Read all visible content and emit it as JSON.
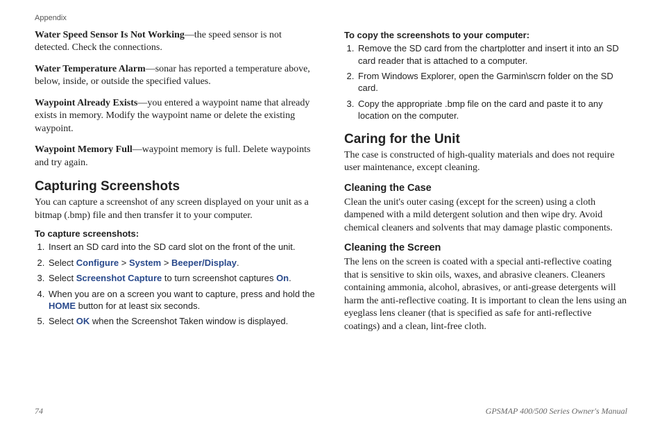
{
  "header": "Appendix",
  "left": {
    "defs": [
      {
        "term": "Water Speed Sensor Is Not Working",
        "desc": "—the speed sensor is not detected. Check the connections."
      },
      {
        "term": "Water Temperature Alarm",
        "desc": "—sonar has reported a temperature above, below, inside, or outside the specified values."
      },
      {
        "term": "Waypoint Already Exists",
        "desc": "—you entered a waypoint name that already exists in memory. Modify the waypoint name or delete the existing waypoint."
      },
      {
        "term": "Waypoint Memory Full",
        "desc": "—waypoint memory is full. Delete waypoints and try again."
      }
    ],
    "h2": "Capturing Screenshots",
    "intro": "You can capture a screenshot of any screen displayed on your unit as a bitmap (.bmp) file and then transfer it to your computer.",
    "proc_title": "To capture screenshots:",
    "step1": "Insert an SD card into the SD card slot on the front of the unit.",
    "step2_pre": "Select ",
    "step2_path1": "Configure",
    "step2_sep": " > ",
    "step2_path2": "System",
    "step2_path3": "Beeper/Display",
    "step2_end": ".",
    "step3_pre": "Select ",
    "step3_b1": "Screenshot Capture",
    "step3_mid": " to turn screenshot captures ",
    "step3_b2": "On",
    "step3_end": ".",
    "step4_pre": "When you are on a screen you want to capture, press and hold the ",
    "step4_b": "HOME",
    "step4_end": " button for at least six seconds.",
    "step5_pre": "Select ",
    "step5_b": "OK",
    "step5_end": " when the Screenshot Taken window is displayed."
  },
  "right": {
    "proc_title": "To copy the screenshots to your computer:",
    "steps": [
      "Remove the SD card from the chartplotter and insert it into an SD card reader that is attached to a computer.",
      "From Windows Explorer, open the Garmin\\scrn folder on the SD card.",
      "Copy the appropriate .bmp file on the card and paste it to any location on the computer."
    ],
    "h2": "Caring for the Unit",
    "intro": "The case is constructed of high-quality materials and does not require user maintenance, except cleaning.",
    "h3a": "Cleaning the Case",
    "body_a": "Clean the unit's outer casing (except for the screen) using a cloth dampened with a mild detergent solution and then wipe dry. Avoid chemical cleaners and solvents that may damage plastic components.",
    "h3b": "Cleaning the Screen",
    "body_b": "The lens on the screen is coated with a special anti-reflective coating that is sensitive to skin oils, waxes, and abrasive cleaners. Cleaners containing ammonia, alcohol, abrasives, or anti-grease detergents will harm the anti-reflective coating. It is important to clean the lens using an eyeglass lens cleaner (that is specified as safe for anti-reflective coatings) and a clean, lint-free cloth."
  },
  "footer": {
    "page_num": "74",
    "manual": "GPSMAP 400/500 Series Owner's Manual"
  }
}
